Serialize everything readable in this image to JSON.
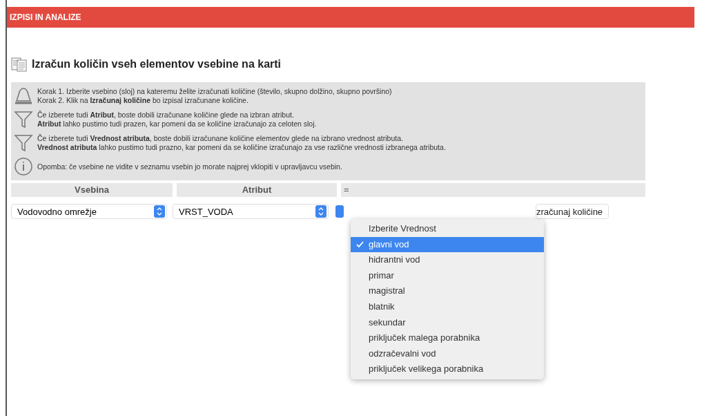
{
  "header": {
    "title": "IZPISI IN ANALIZE"
  },
  "page_title": "Izračun količin vseh elementov vsebine na karti",
  "info": [
    {
      "kind": "bell",
      "lines": [
        "Korak 1. Izberite vsebino (sloj) na kateremu želite izračunati količine (število, skupno dolžino, skupno površino)",
        "Korak 2. Klik na **Izračunaj količine** bo izpisal izračunane količine."
      ]
    },
    {
      "kind": "filter",
      "lines": [
        "Če izberete tudi **Atribut**, boste dobili izračunane količine glede na izbran atribut.",
        "**Atribut** lahko pustimo tudi prazen, kar pomeni da se količine izračunajo za celoten sloj."
      ]
    },
    {
      "kind": "filter",
      "lines": [
        "Če izberete tudi **Vrednost atributa**, boste dobili izračunane količine elementov glede na izbrano vrednost atributa.",
        "**Vrednost atributa** lahko pustimo tudi prazno, kar pomeni da se količine izračunajo za vse različne vrednosti izbranega atributa."
      ]
    },
    {
      "kind": "info",
      "lines": [
        "Opomba: če vsebine ne vidite v seznamu vsebin jo morate najprej vklopiti v upravljavcu vsebin."
      ]
    }
  ],
  "columns": [
    "Vsebina",
    "Atribut",
    "="
  ],
  "selects": [
    {
      "value": "Vodovodno omrežje"
    },
    {
      "value": "VRST_VODA"
    }
  ],
  "button": "zračunaj količine",
  "dropdown": [
    {
      "label": "Izberite Vrednost",
      "selected": false
    },
    {
      "label": "glavni vod",
      "selected": true
    },
    {
      "label": "hidrantni vod",
      "selected": false
    },
    {
      "label": "primar",
      "selected": false
    },
    {
      "label": "magistral",
      "selected": false
    },
    {
      "label": "blatnik",
      "selected": false
    },
    {
      "label": "sekundar",
      "selected": false
    },
    {
      "label": "priključek malega porabnika",
      "selected": false
    },
    {
      "label": "odzračevalni vod",
      "selected": false
    },
    {
      "label": "priključek velikega porabnika",
      "selected": false
    }
  ]
}
